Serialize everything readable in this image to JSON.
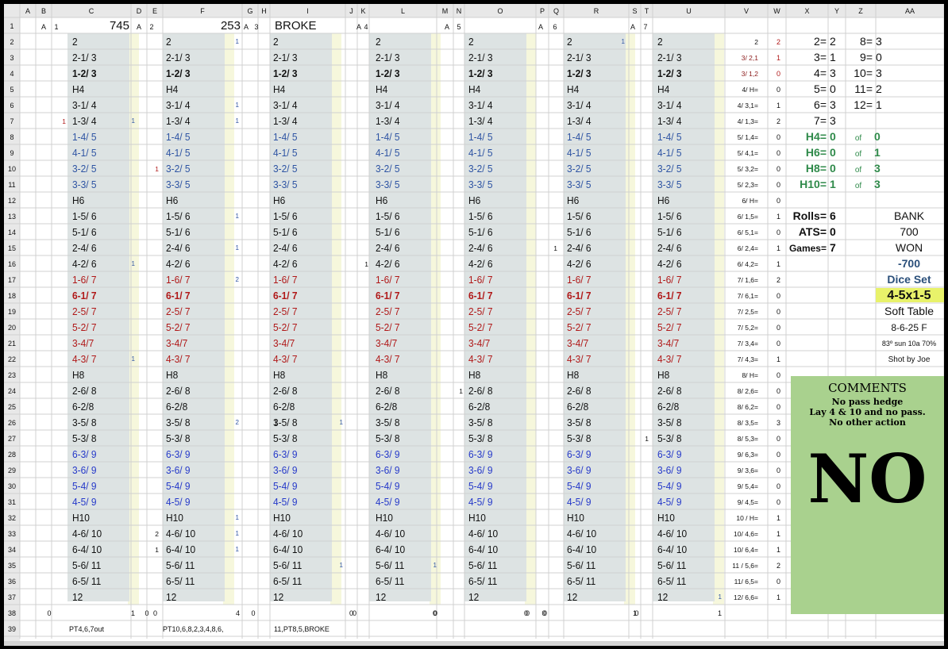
{
  "columns": [
    "A",
    "B",
    "C",
    "D",
    "E",
    "F",
    "G",
    "H",
    "I",
    "J",
    "K",
    "L",
    "M",
    "N",
    "O",
    "P",
    "Q",
    "R",
    "S",
    "T",
    "U",
    "V",
    "W",
    "X",
    "Y",
    "Z",
    "AA"
  ],
  "rows": [
    "1",
    "2",
    "3",
    "4",
    "5",
    "6",
    "7",
    "8",
    "9",
    "10",
    "11",
    "12",
    "13",
    "14",
    "15",
    "16",
    "17",
    "18",
    "19",
    "20",
    "21",
    "22",
    "23",
    "24",
    "25",
    "26",
    "27",
    "28",
    "29",
    "30",
    "31",
    "32",
    "33",
    "34",
    "35",
    "36",
    "37",
    "38",
    "39"
  ],
  "combos": [
    {
      "t": "2",
      "c": "k"
    },
    {
      "t": "2-1/ 3",
      "c": "k"
    },
    {
      "t": "1-2/ 3",
      "c": "k"
    },
    {
      "t": "H4",
      "c": "k"
    },
    {
      "t": "3-1/ 4",
      "c": "k"
    },
    {
      "t": "1-3/ 4",
      "c": "k"
    },
    {
      "t": "1-4/ 5",
      "c": "b"
    },
    {
      "t": "4-1/ 5",
      "c": "b"
    },
    {
      "t": "3-2/ 5",
      "c": "b"
    },
    {
      "t": "3-3/ 5",
      "c": "b"
    },
    {
      "t": "H6",
      "c": "k"
    },
    {
      "t": "1-5/ 6",
      "c": "k"
    },
    {
      "t": "5-1/ 6",
      "c": "k"
    },
    {
      "t": "2-4/ 6",
      "c": "k"
    },
    {
      "t": "4-2/ 6",
      "c": "k"
    },
    {
      "t": "1-6/ 7",
      "c": "r"
    },
    {
      "t": "6-1/ 7",
      "c": "R"
    },
    {
      "t": "2-5/ 7",
      "c": "r"
    },
    {
      "t": "5-2/ 7",
      "c": "r"
    },
    {
      "t": "3-4/7",
      "c": "r"
    },
    {
      "t": "4-3/ 7",
      "c": "r"
    },
    {
      "t": "H8",
      "c": "k"
    },
    {
      "t": "2-6/ 8",
      "c": "k"
    },
    {
      "t": "6-2/8",
      "c": "k"
    },
    {
      "t": "3-5/ 8",
      "c": "k"
    },
    {
      "t": "5-3/ 8",
      "c": "k"
    },
    {
      "t": "6-3/ 9",
      "c": "u"
    },
    {
      "t": "3-6/ 9",
      "c": "u"
    },
    {
      "t": "5-4/ 9",
      "c": "u"
    },
    {
      "t": "4-5/ 9",
      "c": "u"
    },
    {
      "t": "H10",
      "c": "k"
    },
    {
      "t": "4-6/ 10",
      "c": "k"
    },
    {
      "t": "6-4/ 10",
      "c": "k"
    },
    {
      "t": "5-6/ 11",
      "c": "k"
    },
    {
      "t": "6-5/ 11",
      "c": "k"
    },
    {
      "t": "12",
      "c": "k"
    }
  ],
  "shooters": [
    {
      "label": "A",
      "num": "1",
      "header": "745",
      "left_zero": "0",
      "right_total": "1",
      "notes": "PT4,6,7out",
      "left_marks": {
        "7": "1"
      },
      "right_marks": {
        "7": "1",
        "16": "1",
        "22": "1"
      },
      "mid_marks": {}
    },
    {
      "label": "A",
      "num": "2",
      "header": "253",
      "left_zero": "0",
      "right_total": "4",
      "notes": "PT10,6,8,2,3,4,8,6,",
      "left_marks": {
        "10": "1",
        "33": "2",
        "34": "1"
      },
      "right_marks": {
        "2": "1",
        "6": "1",
        "7": "1",
        "13": "1",
        "15": "1",
        "17": "2",
        "26": "2",
        "32": "1",
        "33": "1",
        "34": "1"
      },
      "mid_marks": {}
    },
    {
      "label": "A",
      "num": "3",
      "header": "BROKE",
      "left_zero": "0",
      "right_total": "0",
      "notes": "11,PT8,5,BROKE",
      "left_marks": {},
      "right_marks": {
        "26": "1",
        "35": "1"
      },
      "mid_marks": {
        "26": "1"
      }
    },
    {
      "label": "A",
      "num": "4",
      "header": "",
      "left_zero": "",
      "right_total": "0",
      "notes": "",
      "left_marks": {
        "16": "1"
      },
      "right_marks": {
        "35": "1"
      },
      "mid_marks": {}
    },
    {
      "label": "A",
      "num": "5",
      "header": "",
      "left_zero": "",
      "right_total": "0",
      "notes": "",
      "left_marks": {
        "24": "1"
      },
      "right_marks": {},
      "mid_marks": {}
    },
    {
      "label": "A",
      "num": "6",
      "header": "",
      "left_zero": "0",
      "right_total": "1",
      "notes": "",
      "left_marks": {
        "15": "1"
      },
      "right_marks": {
        "2": "1"
      },
      "mid_marks": {}
    },
    {
      "label": "A",
      "num": "7",
      "header": "",
      "left_zero": "0",
      "right_total": "1",
      "notes": "",
      "left_marks": {
        "27": "1"
      },
      "right_marks": {
        "37": "1"
      },
      "mid_marks": {}
    }
  ],
  "tally": [
    {
      "label": "2",
      "val": "2",
      "c": "k"
    },
    {
      "label": "3/ 2,1",
      "val": "1",
      "c": "r"
    },
    {
      "label": "3/ 1,2",
      "val": "0",
      "c": "r"
    },
    {
      "label": "4/ H=",
      "val": "0",
      "c": "k"
    },
    {
      "label": "4/ 3,1=",
      "val": "1",
      "c": "k"
    },
    {
      "label": "4/ 1,3=",
      "val": "2",
      "c": "k"
    },
    {
      "label": "5/ 1,4=",
      "val": "0",
      "c": "k"
    },
    {
      "label": "5/ 4,1=",
      "val": "0",
      "c": "k"
    },
    {
      "label": "5/ 3,2=",
      "val": "0",
      "c": "k"
    },
    {
      "label": "5/ 2,3=",
      "val": "0",
      "c": "k"
    },
    {
      "label": "6/ H=",
      "val": "0",
      "c": "k"
    },
    {
      "label": "6/ 1,5=",
      "val": "1",
      "c": "k"
    },
    {
      "label": "6/ 5,1=",
      "val": "0",
      "c": "k"
    },
    {
      "label": "6/ 2,4=",
      "val": "1",
      "c": "k"
    },
    {
      "label": "6/ 4,2=",
      "val": "1",
      "c": "k"
    },
    {
      "label": "7/ 1,6=",
      "val": "2",
      "c": "k"
    },
    {
      "label": "7/ 6,1=",
      "val": "0",
      "c": "k"
    },
    {
      "label": "7/ 2,5=",
      "val": "0",
      "c": "k"
    },
    {
      "label": "7/ 5,2=",
      "val": "0",
      "c": "k"
    },
    {
      "label": "7/ 3,4=",
      "val": "0",
      "c": "k"
    },
    {
      "label": "7/ 4,3=",
      "val": "1",
      "c": "k"
    },
    {
      "label": "8/ H=",
      "val": "0",
      "c": "k"
    },
    {
      "label": "8/ 2,6=",
      "val": "0",
      "c": "k"
    },
    {
      "label": "8/ 6,2=",
      "val": "0",
      "c": "k"
    },
    {
      "label": "8/ 3,5=",
      "val": "3",
      "c": "k"
    },
    {
      "label": "8/ 5,3=",
      "val": "0",
      "c": "k"
    },
    {
      "label": "9/ 6,3=",
      "val": "0",
      "c": "k"
    },
    {
      "label": "9/ 3,6=",
      "val": "0",
      "c": "k"
    },
    {
      "label": "9/ 5,4=",
      "val": "0",
      "c": "k"
    },
    {
      "label": "9/ 4,5=",
      "val": "0",
      "c": "k"
    },
    {
      "label": "10 / H=",
      "val": "1",
      "c": "k"
    },
    {
      "label": "10/ 4,6=",
      "val": "1",
      "c": "k"
    },
    {
      "label": "10/ 6,4=",
      "val": "1",
      "c": "k"
    },
    {
      "label": "11 / 5,6=",
      "val": "2",
      "c": "k"
    },
    {
      "label": "11/ 6,5=",
      "val": "0",
      "c": "k"
    },
    {
      "label": "12/ 6,6=",
      "val": "1",
      "c": "k"
    }
  ],
  "sum_counts": [
    {
      "a": "2=",
      "b": "2",
      "c": "8=",
      "d": "3"
    },
    {
      "a": "3=",
      "b": "1",
      "c": "9=",
      "d": "0"
    },
    {
      "a": "4=",
      "b": "3",
      "c": "10=",
      "d": "3"
    },
    {
      "a": "5=",
      "b": "0",
      "c": "11=",
      "d": "2"
    },
    {
      "a": "6=",
      "b": "3",
      "c": "12=",
      "d": "1"
    },
    {
      "a": "7=",
      "b": "3",
      "c": "",
      "d": ""
    }
  ],
  "hardways": [
    {
      "label": "H4=",
      "val": "0",
      "of": "of",
      "total": "0"
    },
    {
      "label": "H6=",
      "val": "0",
      "of": "of",
      "total": "1"
    },
    {
      "label": "H8=",
      "val": "0",
      "of": "of",
      "total": "3"
    },
    {
      "label": "H10=",
      "val": "1",
      "of": "of",
      "total": "3"
    }
  ],
  "stats": {
    "rolls_label": "Rolls=",
    "rolls": "6",
    "ats_label": "ATS=",
    "ats": "0",
    "games_label": "Games=",
    "games": "7"
  },
  "summary": {
    "bank_label": "BANK",
    "bank": "700",
    "won_label": "WON",
    "won": "-700",
    "dice_set_label": "Dice Set",
    "dice_set": "4-5x1-5",
    "table": "Soft Table",
    "date": "8-6-25 F",
    "weather": "83º sun 10a 70%",
    "shooter": "Shot by Joe"
  },
  "comments": {
    "title": "COMMENTS",
    "line1": "No pass hedge",
    "line2": "Lay 4 & 10 and no pass. No other action",
    "big": "NO"
  },
  "colors": {
    "header_bg": "#e8e8e8",
    "gridline": "#d0d0d0",
    "combo_panel": "#dde3e3",
    "cream": "#f6f7dc",
    "black": "#111111",
    "blue": "#2e54a3",
    "red": "#b01818",
    "green": "#2f8a4a",
    "navy": "#2a4f7a",
    "yellow": "#e8f26a",
    "comment_bg": "#a9d18e"
  }
}
